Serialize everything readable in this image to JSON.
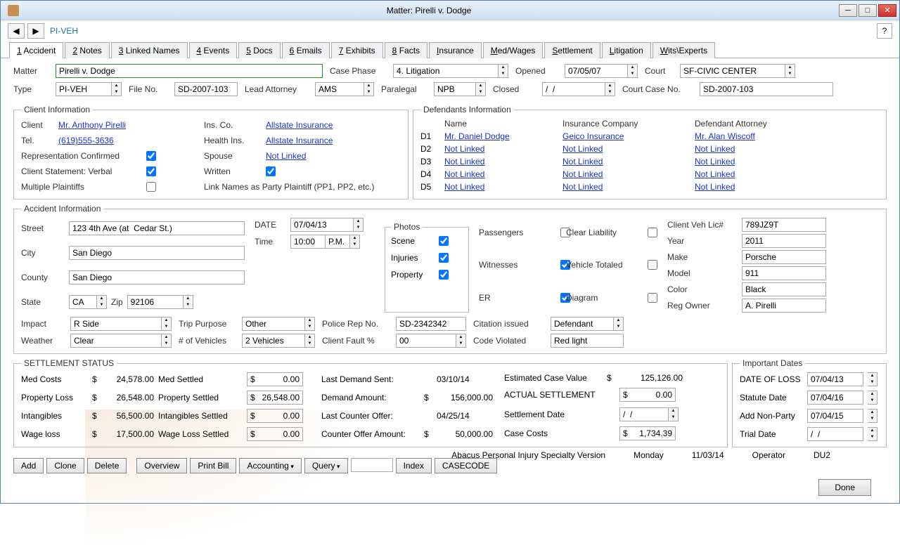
{
  "window": {
    "title": "Matter: Pirelli v. Dodge"
  },
  "breadcrumb": "PI-VEH",
  "tabs": [
    {
      "label": "1 Accident",
      "active": true
    },
    {
      "label": "2 Notes"
    },
    {
      "label": "3 Linked Names"
    },
    {
      "label": "4 Events"
    },
    {
      "label": "5 Docs"
    },
    {
      "label": "6 Emails"
    },
    {
      "label": "7 Exhibits"
    },
    {
      "label": "8 Facts"
    },
    {
      "label": "Insurance"
    },
    {
      "label": "Med/Wages"
    },
    {
      "label": "Settlement"
    },
    {
      "label": "Litigation"
    },
    {
      "label": "Wits\\Experts"
    }
  ],
  "header": {
    "matter_label": "Matter",
    "matter_value": "Pirelli v. Dodge",
    "case_phase_label": "Case Phase",
    "case_phase_value": "4. Litigation",
    "opened_label": "Opened",
    "opened_value": "07/05/07",
    "court_label": "Court",
    "court_value": "SF-CIVIC CENTER",
    "type_label": "Type",
    "type_value": "PI-VEH",
    "file_no_label": "File No.",
    "file_no_value": "SD-2007-103",
    "lead_attorney_label": "Lead Attorney",
    "lead_attorney_value": "AMS",
    "paralegal_label": "Paralegal",
    "paralegal_value": "NPB",
    "closed_label": "Closed",
    "closed_value": "/  /",
    "court_case_no_label": "Court Case No.",
    "court_case_no_value": "SD-2007-103"
  },
  "client_info": {
    "legend": "Client Information",
    "client_label": "Client",
    "client_value": "Mr. Anthony Pirelli",
    "tel_label": "Tel.",
    "tel_value": "(619)555-3636",
    "rep_confirmed": "Representation Confirmed",
    "client_stmt": "Client Statement: Verbal",
    "multiple_plaintiffs": "Multiple Plaintiffs",
    "ins_co": "Ins. Co.",
    "ins_co_value": "Allstate Insurance",
    "health_ins": "Health Ins.",
    "health_ins_value": "Allstate Insurance",
    "spouse": "Spouse",
    "spouse_value": "Not Linked",
    "written": "Written",
    "link_names": "Link Names as Party Plaintiff (PP1, PP2, etc.)"
  },
  "defendants": {
    "legend": "Defendants Information",
    "name_header": "Name",
    "ins_header": "Insurance Company",
    "atty_header": "Defendant Attorney",
    "rows": [
      {
        "id": "D1",
        "name": "Mr. Daniel Dodge",
        "ins": "Geico Insurance",
        "atty": "Mr. Alan Wiscoff"
      },
      {
        "id": "D2",
        "name": "Not Linked",
        "ins": "Not Linked",
        "atty": "Not Linked"
      },
      {
        "id": "D3",
        "name": "Not Linked",
        "ins": "Not Linked",
        "atty": "Not Linked"
      },
      {
        "id": "D4",
        "name": "Not Linked",
        "ins": "Not Linked",
        "atty": "Not Linked"
      },
      {
        "id": "D5",
        "name": "Not Linked",
        "ins": "Not Linked",
        "atty": "Not Linked"
      }
    ]
  },
  "accident": {
    "legend": "Accident Information",
    "street_label": "Street",
    "street": "123 4th Ave (at  Cedar St.)",
    "city_label": "City",
    "city": "San Diego",
    "county_label": "County",
    "county": "San Diego",
    "state_label": "State",
    "state": "CA",
    "zip_label": "Zip",
    "zip": "92106",
    "date_label": "DATE",
    "date": "07/04/13",
    "time_label": "Time",
    "time": "10:00",
    "ampm": "P.M.",
    "impact_label": "Impact",
    "impact": "R Side",
    "weather_label": "Weather",
    "weather": "Clear",
    "trip_label": "Trip Purpose",
    "trip": "Other",
    "vehicles_label": "# of Vehicles",
    "vehicles": "2 Vehicles",
    "police_label": "Police Rep No.",
    "police": "SD-2342342",
    "fault_label": "Client Fault %",
    "fault": "00",
    "citation_label": "Citation issued",
    "citation": "Defendant",
    "code_label": "Code Violated",
    "code": "Red light",
    "photos_legend": "Photos",
    "photos": {
      "scene": "Scene",
      "injuries": "Injuries",
      "property": "Property"
    },
    "flags": {
      "passengers": "Passengers",
      "witnesses": "Witnesses",
      "er": "ER",
      "clear_liability": "Clear Liability",
      "vehicle_totaled": "Vehicle Totaled",
      "diagram": "Diagram"
    },
    "vehicle": {
      "lic_label": "Client Veh Lic#",
      "lic": "789JZ9T",
      "year_label": "Year",
      "year": "2011",
      "make_label": "Make",
      "make": "Porsche",
      "model_label": "Model",
      "model": "911",
      "color_label": "Color",
      "color": "Black",
      "owner_label": "Reg Owner",
      "owner": "A. Pirelli"
    }
  },
  "settlement": {
    "legend": "SETTLEMENT STATUS",
    "med_costs_label": "Med Costs",
    "med_costs": "24,578.00",
    "property_loss_label": "Property Loss",
    "property_loss": "26,548.00",
    "intangibles_label": "Intangibles",
    "intangibles": "56,500.00",
    "wage_loss_label": "Wage loss",
    "wage_loss": "17,500.00",
    "med_settled_label": "Med Settled",
    "med_settled": "0.00",
    "property_settled_label": "Property Settled",
    "property_settled": "26,548.00",
    "intangibles_settled_label": "Intangibles Settled",
    "intangibles_settled": "0.00",
    "wage_settled_label": "Wage Loss Settled",
    "wage_settled": "0.00",
    "last_demand_label": "Last Demand Sent:",
    "last_demand": "03/10/14",
    "demand_amt_label": "Demand Amount:",
    "demand_amt": "156,000.00",
    "last_counter_label": "Last Counter Offer:",
    "last_counter": "04/25/14",
    "counter_amt_label": "Counter Offer Amount:",
    "counter_amt": "50,000.00",
    "est_value_label": "Estimated Case Value",
    "est_value": "125,126.00",
    "actual_label": "ACTUAL SETTLEMENT",
    "actual": "0.00",
    "settle_date_label": "Settlement Date",
    "settle_date": "/  /",
    "case_costs_label": "Case Costs",
    "case_costs": "1,734.39"
  },
  "dates": {
    "legend": "Important Dates",
    "dol_label": "DATE OF LOSS",
    "dol": "07/04/13",
    "statute_label": "Statute Date",
    "statute": "07/04/16",
    "nonparty_label": "Add Non-Party",
    "nonparty": "07/04/15",
    "trial_label": "Trial Date",
    "trial": "/  /"
  },
  "footer": {
    "product": "Abacus Personal Injury Specialty Version",
    "day": "Monday",
    "date": "11/03/14",
    "operator_label": "Operator",
    "operator": "DU2"
  },
  "buttons": {
    "add": "Add",
    "clone": "Clone",
    "delete": "Delete",
    "overview": "Overview",
    "print_bill": "Print Bill",
    "accounting": "Accounting",
    "query": "Query",
    "index": "Index",
    "casecode": "CASECODE",
    "done": "Done"
  },
  "dollar": "$"
}
